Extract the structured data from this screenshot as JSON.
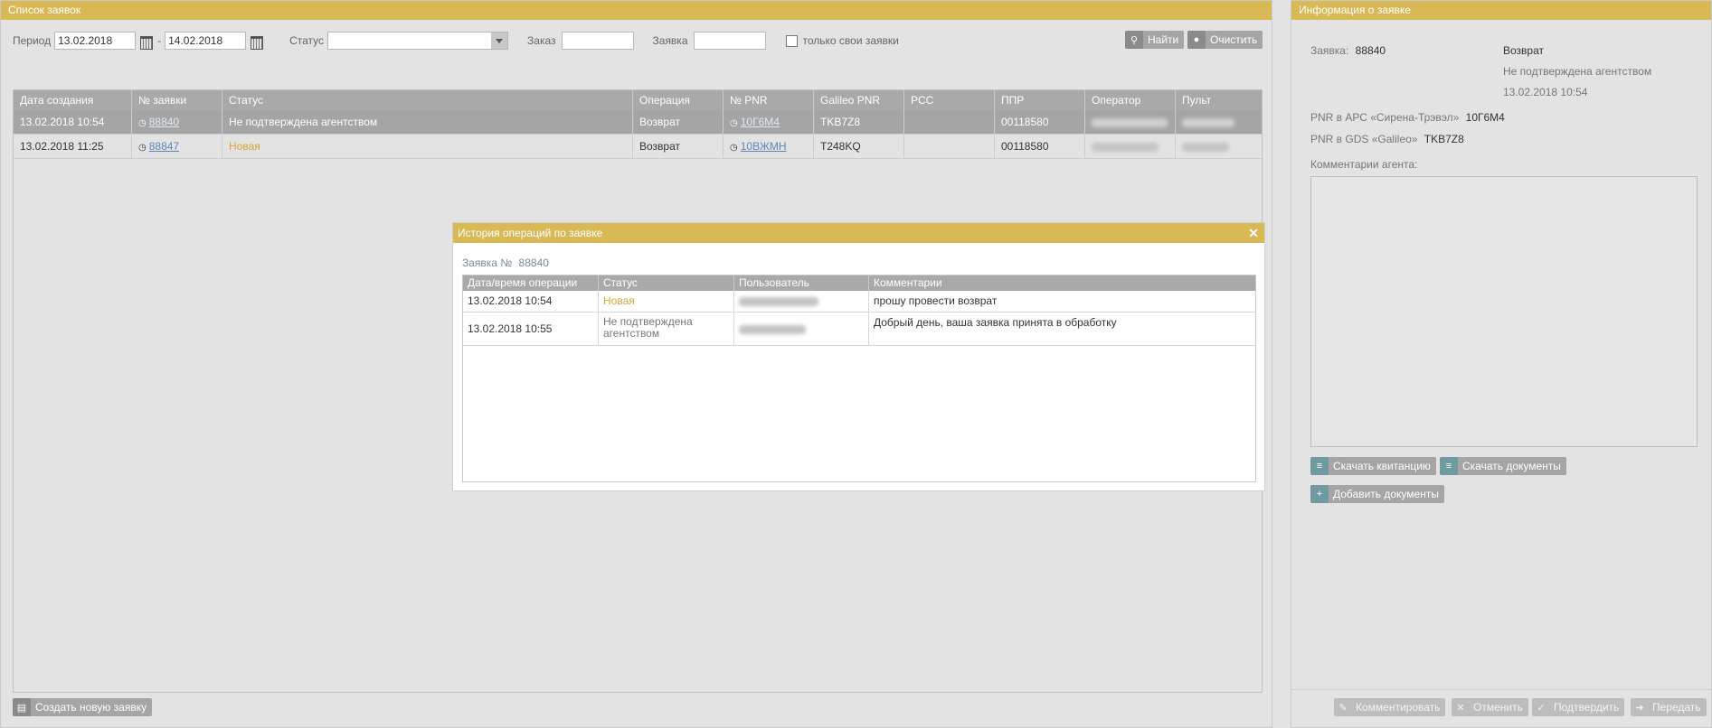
{
  "list_panel": {
    "title": "Список заявок",
    "filters": {
      "period_label": "Период",
      "date_from": "13.02.2018",
      "dash": "-",
      "date_to": "14.02.2018",
      "status_label": "Статус",
      "status_value": "",
      "order_label": "Заказ",
      "order_value": "",
      "request_label": "Заявка",
      "request_value": "",
      "own_only_label": "только свои заявки"
    },
    "buttons": {
      "find": "Найти",
      "clear": "Очистить",
      "create": "Создать новую заявку"
    },
    "columns": [
      "Дата создания",
      "№ заявки",
      "Статус",
      "Операция",
      "№ PNR",
      "Galileo PNR",
      "PCC",
      "ППР",
      "Оператор",
      "Пульт"
    ],
    "rows": [
      {
        "created": "13.02.2018 10:54",
        "number": "88840",
        "status": "Не подтверждена агентством",
        "operation": "Возврат",
        "pnr": "10Г6М4",
        "galileo": "TKB7Z8",
        "pcc": "",
        "ppr": "00118580"
      },
      {
        "created": "13.02.2018 11:25",
        "number": "88847",
        "status": "Новая",
        "operation": "Возврат",
        "pnr": "10ВЖМН",
        "galileo": "T248KQ",
        "pcc": "",
        "ppr": "00118580"
      }
    ]
  },
  "modal": {
    "title": "История операций по заявке",
    "subtitle_label": "Заявка №",
    "subtitle_number": "88840",
    "columns": [
      "Дата/время операции",
      "Статус",
      "Пользователь",
      "Комментарии"
    ],
    "rows": [
      {
        "datetime": "13.02.2018 10:54",
        "status": "Новая",
        "comment": "прошу провести возврат"
      },
      {
        "datetime": "13.02.2018 10:55",
        "status": "Не подтверждена агентством",
        "comment": "Добрый день, ваша заявка принята в обработку"
      }
    ]
  },
  "info_panel": {
    "title": "Информация о заявке",
    "request_label": "Заявка:",
    "request_number": "88840",
    "operation": "Возврат",
    "status": "Не подтверждена агентством",
    "date": "13.02.2018 10:54",
    "pnr_label": "PNR в АРС «Сирена-Трэвэл»",
    "pnr_value": "10Г6М4",
    "gds_label": "PNR в GDS «Galileo»",
    "gds_value": "TKB7Z8",
    "comments_label": "Комментарии агента:",
    "buttons": {
      "download_receipt": "Скачать квитанцию",
      "download_docs": "Скачать документы",
      "add_docs": "Добавить документы",
      "comment": "Комментировать",
      "cancel": "Отменить",
      "confirm": "Подтвердить",
      "transfer": "Передать"
    }
  },
  "colors": {
    "header": "#d8b956",
    "selected_row": "#a5a5a5",
    "new_status": "#d8a533",
    "link": "#5f87b5"
  }
}
